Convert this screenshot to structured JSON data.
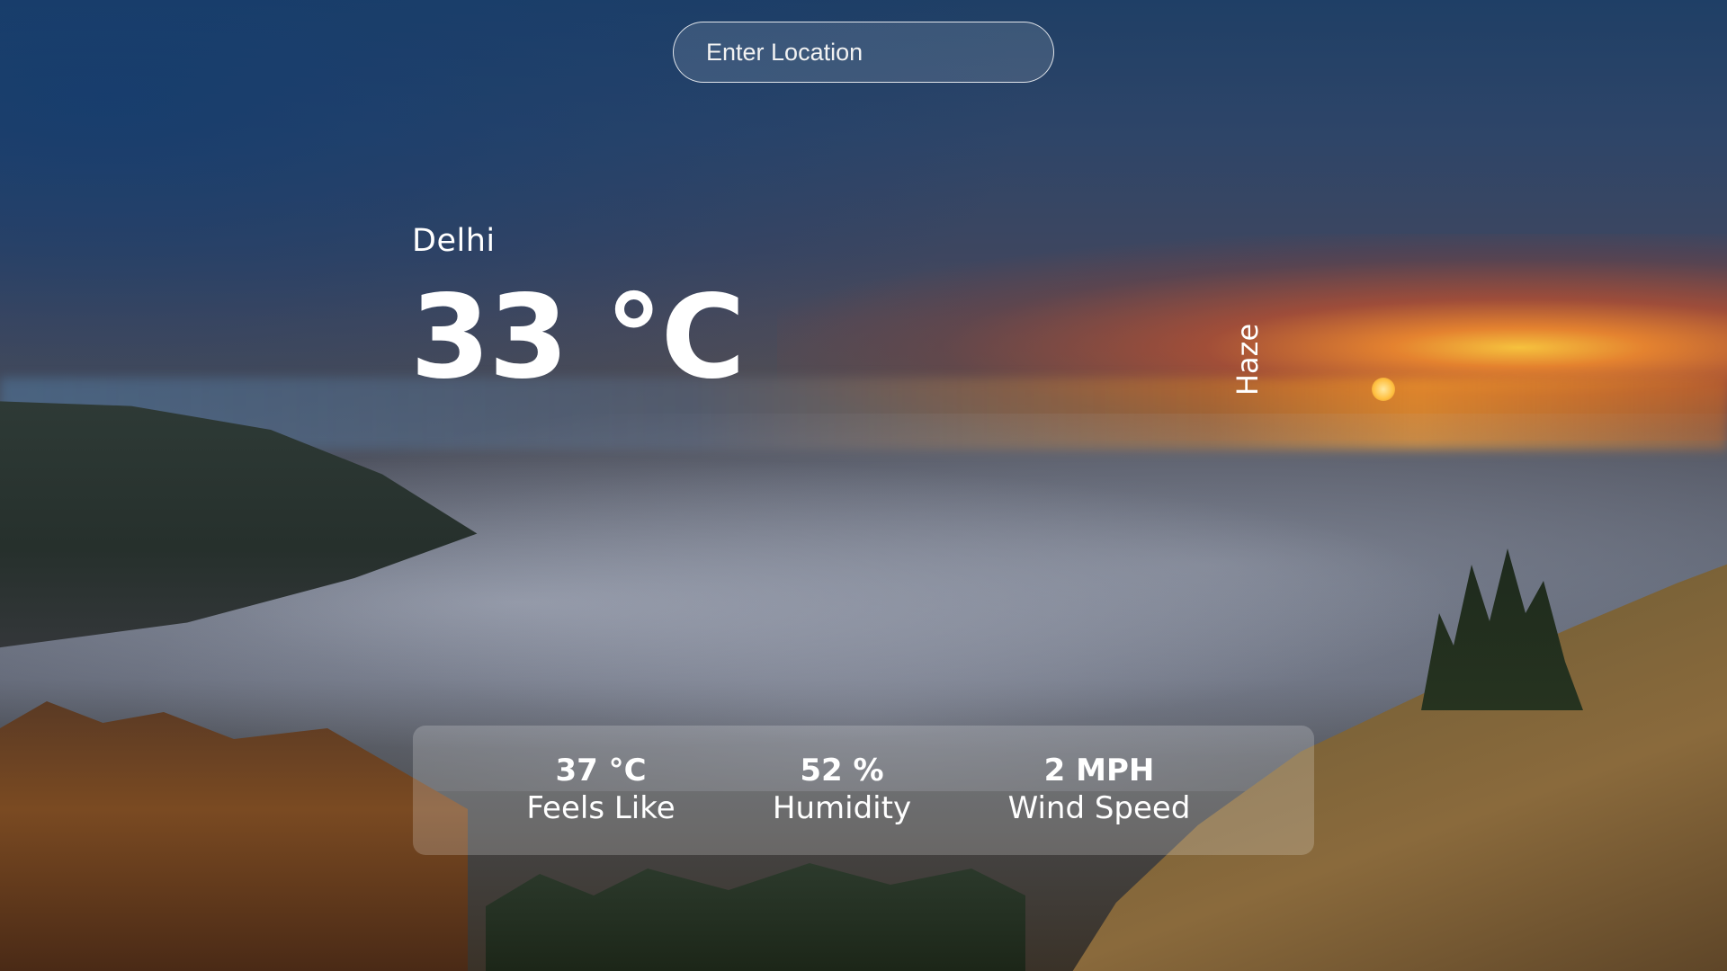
{
  "search": {
    "placeholder": "Enter Location"
  },
  "weather": {
    "location": "Delhi",
    "temperature": "33 °C",
    "condition": "Haze"
  },
  "stats": {
    "feels_like": {
      "value": "37 °C",
      "label": "Feels Like"
    },
    "humidity": {
      "value": "52 %",
      "label": "Humidity"
    },
    "wind_speed": {
      "value": "2 MPH",
      "label": "Wind Speed"
    }
  }
}
